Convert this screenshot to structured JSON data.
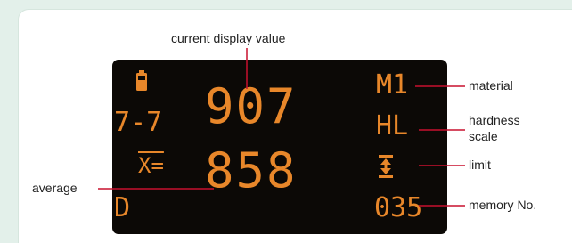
{
  "display": {
    "reading_value": "907",
    "average_value": "858",
    "average_prefix": "X=",
    "impact_count": "7-7",
    "material_code": "M1",
    "hardness_scale_code": "HL",
    "memory_number": "035",
    "probe_type": "D"
  },
  "labels": {
    "current_display_value": "current display value",
    "material": "material",
    "hardness_scale_line1": "hardness",
    "hardness_scale_line2": "scale",
    "limit": "limit",
    "average": "average",
    "memory_no": "memory No."
  },
  "colors": {
    "background": "#e3f0ea",
    "card": "#ffffff",
    "screen": "#0c0906",
    "lcd_text": "#e8872a",
    "leader_line": "#c8102e"
  },
  "icons": [
    "battery-icon",
    "limit-arrows-icon"
  ]
}
